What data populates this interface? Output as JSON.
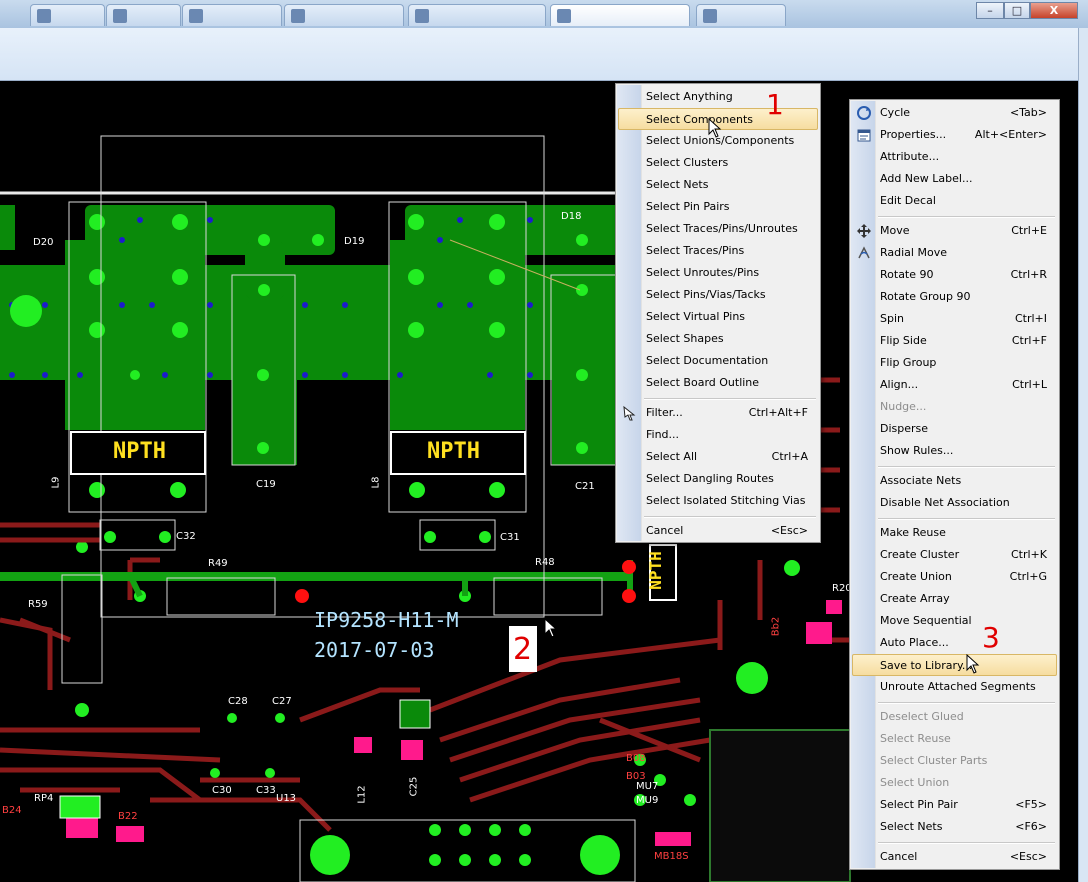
{
  "browser": {
    "tabs": [
      {
        "label": ""
      },
      {
        "label": ""
      },
      {
        "label": ""
      },
      {
        "label": ""
      },
      {
        "label": ""
      },
      {
        "label": ""
      }
    ],
    "window_controls": {
      "minimize": "–",
      "maximize": "□",
      "close": "X"
    }
  },
  "board": {
    "component_labels": {
      "d20": "D20",
      "d19": "D19",
      "d18": "D18",
      "l9": "L9",
      "l8": "L8",
      "c19": "C19",
      "c21": "C21",
      "c32": "C32",
      "c31": "C31",
      "r49": "R49",
      "r48": "R48",
      "r59": "R59",
      "c28": "C28",
      "c27": "C27",
      "c30": "C30",
      "c33": "C33",
      "u13": "U13",
      "l12": "L12",
      "c25": "C25",
      "rp4": "RP4",
      "b24": "B24",
      "b22": "B22",
      "b08": "B08",
      "b03": "B03",
      "mu7": "MU7",
      "mu9": "MU9",
      "mb18s": "MB18S",
      "r20": "R20",
      "bb2": "Bb2"
    },
    "npth_left": "NPTH",
    "npth_right": "NPTH",
    "npth_vertical": "NPTH",
    "silk_line1": "IP9258-H11-M",
    "silk_line2": "2017-07-03",
    "colors": {
      "pad": "#22ee22",
      "plane": "#0a8a0a",
      "trace": "#8b1a1a",
      "via": "#1c1ccc",
      "silk": "#ffffff",
      "selected": "#ff1a8c"
    }
  },
  "steps": {
    "one": "1",
    "two": "2",
    "three": "3"
  },
  "menu_left": {
    "items": [
      {
        "label": "Select Anything",
        "shortcut": ""
      },
      {
        "label": "Select Components",
        "shortcut": ""
      },
      {
        "label": "Select Unions/Components",
        "shortcut": ""
      },
      {
        "label": "Select Clusters",
        "shortcut": ""
      },
      {
        "label": "Select Nets",
        "shortcut": ""
      },
      {
        "label": "Select Pin Pairs",
        "shortcut": ""
      },
      {
        "label": "Select Traces/Pins/Unroutes",
        "shortcut": ""
      },
      {
        "label": "Select Traces/Pins",
        "shortcut": ""
      },
      {
        "label": "Select Unroutes/Pins",
        "shortcut": ""
      },
      {
        "label": "Select Pins/Vias/Tacks",
        "shortcut": ""
      },
      {
        "label": "Select Virtual Pins",
        "shortcut": ""
      },
      {
        "label": "Select Shapes",
        "shortcut": ""
      },
      {
        "label": "Select Documentation",
        "shortcut": ""
      },
      {
        "label": "Select Board Outline",
        "shortcut": ""
      },
      {
        "label": "Filter...",
        "shortcut": "Ctrl+Alt+F"
      },
      {
        "label": "Find...",
        "shortcut": ""
      },
      {
        "label": "Select All",
        "shortcut": "Ctrl+A"
      },
      {
        "label": "Select Dangling Routes",
        "shortcut": ""
      },
      {
        "label": "Select Isolated Stitching Vias",
        "shortcut": ""
      },
      {
        "label": "Cancel",
        "shortcut": "<Esc>"
      }
    ]
  },
  "menu_right": {
    "items": [
      {
        "label": "Cycle",
        "shortcut": "<Tab>"
      },
      {
        "label": "Properties...",
        "shortcut": "Alt+<Enter>"
      },
      {
        "label": "Attribute...",
        "shortcut": ""
      },
      {
        "label": "Add New Label...",
        "shortcut": ""
      },
      {
        "label": "Edit Decal",
        "shortcut": ""
      },
      {
        "label": "Move",
        "shortcut": "Ctrl+E"
      },
      {
        "label": "Radial Move",
        "shortcut": ""
      },
      {
        "label": "Rotate 90",
        "shortcut": "Ctrl+R"
      },
      {
        "label": "Rotate Group 90",
        "shortcut": ""
      },
      {
        "label": "Spin",
        "shortcut": "Ctrl+I"
      },
      {
        "label": "Flip Side",
        "shortcut": "Ctrl+F"
      },
      {
        "label": "Flip Group",
        "shortcut": ""
      },
      {
        "label": "Align...",
        "shortcut": "Ctrl+L"
      },
      {
        "label": "Nudge...",
        "shortcut": ""
      },
      {
        "label": "Disperse",
        "shortcut": ""
      },
      {
        "label": "Show Rules...",
        "shortcut": ""
      },
      {
        "label": "Associate Nets",
        "shortcut": ""
      },
      {
        "label": "Disable Net Association",
        "shortcut": ""
      },
      {
        "label": "Make Reuse",
        "shortcut": ""
      },
      {
        "label": "Create Cluster",
        "shortcut": "Ctrl+K"
      },
      {
        "label": "Create Union",
        "shortcut": "Ctrl+G"
      },
      {
        "label": "Create Array",
        "shortcut": ""
      },
      {
        "label": "Move Sequential",
        "shortcut": ""
      },
      {
        "label": "Auto Place...",
        "shortcut": ""
      },
      {
        "label": "Save to Library...",
        "shortcut": ""
      },
      {
        "label": "Unroute Attached Segments",
        "shortcut": ""
      },
      {
        "label": "Deselect Glued",
        "shortcut": ""
      },
      {
        "label": "Select Reuse",
        "shortcut": ""
      },
      {
        "label": "Select Cluster Parts",
        "shortcut": ""
      },
      {
        "label": "Select Union",
        "shortcut": ""
      },
      {
        "label": "Select Pin Pair",
        "shortcut": "<F5>"
      },
      {
        "label": "Select Nets",
        "shortcut": "<F6>"
      },
      {
        "label": "Cancel",
        "shortcut": "<Esc>"
      }
    ]
  }
}
